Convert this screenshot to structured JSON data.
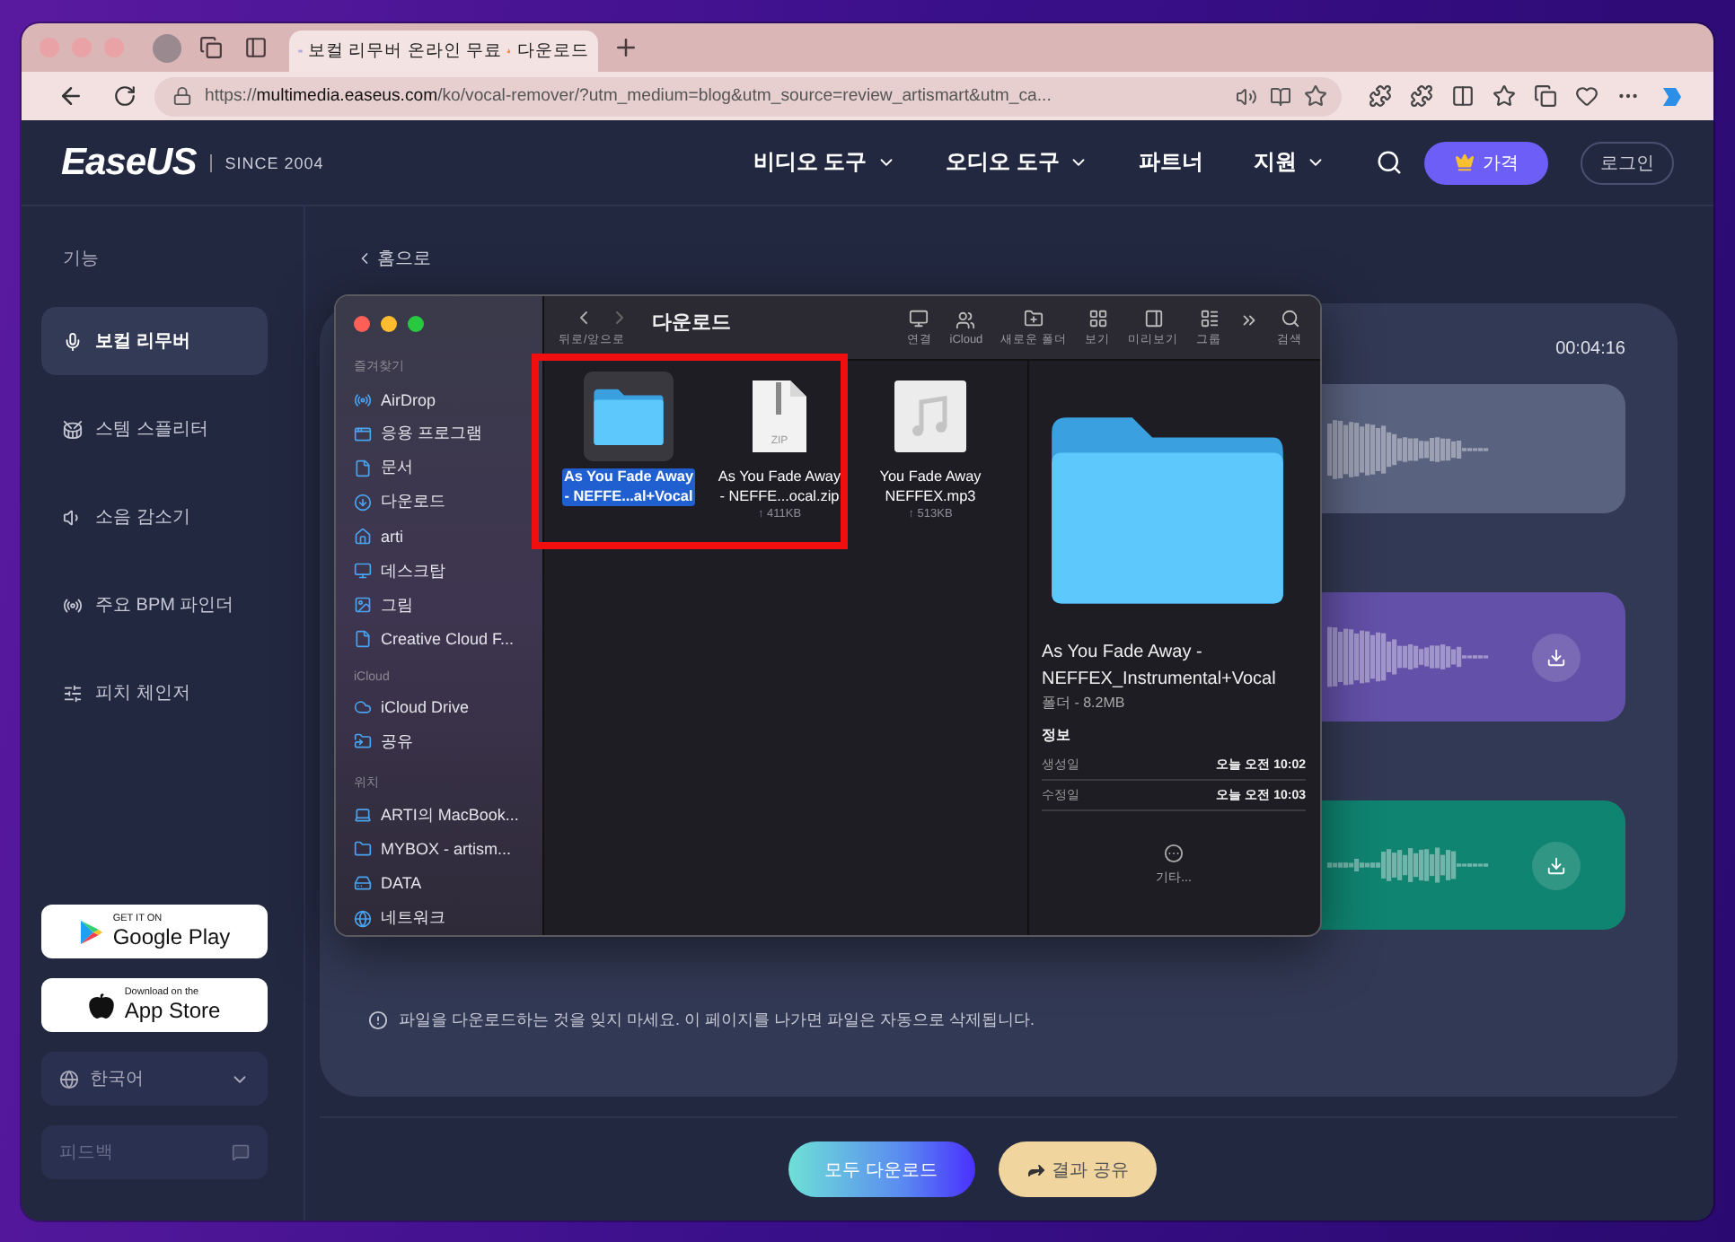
{
  "browser": {
    "tab_title_start": "보컬 리무버 온라인 무료",
    "tab_title_end": "다운로드",
    "url": "https://**multimedia.easeus.com**/ko/vocal-remover/?utm_medium=blog&utm_source=review_artismart&utm_ca..."
  },
  "header": {
    "logo": "EaseUS",
    "since": "SINCE 2004",
    "nav": [
      {
        "label": "비디오 도구",
        "menu": true
      },
      {
        "label": "오디오 도구",
        "menu": true
      },
      {
        "label": "파트너",
        "menu": false
      },
      {
        "label": "지원",
        "menu": true
      }
    ],
    "price_button": "가격",
    "login_button": "로그인"
  },
  "sidebar": {
    "section": "기능",
    "items": [
      {
        "label": "보컬 리무버",
        "kind": "vocal",
        "selected": true
      },
      {
        "label": "스템 스플리터",
        "kind": "stem",
        "selected": false
      },
      {
        "label": "소음 감소기",
        "kind": "noise",
        "selected": false
      },
      {
        "label": "주요 BPM 파인더",
        "kind": "bpm",
        "selected": false
      },
      {
        "label": "피치 체인저",
        "kind": "pitch",
        "selected": false
      }
    ],
    "google_play": {
      "small": "GET IT ON",
      "big": "Google Play"
    },
    "app_store": {
      "small": "Download on the",
      "big": "App Store"
    },
    "language": "한국어",
    "feedback": "피드백"
  },
  "main": {
    "back": "홈으로",
    "duration": "00:04:16",
    "tracks": [
      {
        "kind": "original",
        "color": "#59627f",
        "download": false
      },
      {
        "kind": "instrumental",
        "color": "#6350a8",
        "download": true
      },
      {
        "kind": "vocal",
        "color": "#0f8470",
        "download": true
      }
    ],
    "notice": "파일을 다운로드하는 것을 잊지 마세요. 이 페이지를 나가면 파일은 자동으로 삭제됩니다.",
    "download_all": "모두 다운로드",
    "share": "결과 공유"
  },
  "finder": {
    "title": "다운로드",
    "nav_label": "뒤로/앞으로",
    "toolbar": [
      {
        "kind": "connect",
        "label": "연결"
      },
      {
        "kind": "icloud",
        "label": "iCloud"
      },
      {
        "kind": "newfolder",
        "label": "새로운 폴더"
      },
      {
        "kind": "view",
        "label": "보기"
      },
      {
        "kind": "preview",
        "label": "미리보기"
      },
      {
        "kind": "group",
        "label": "그룹"
      },
      {
        "kind": "more"
      },
      {
        "kind": "search",
        "label": "검색"
      }
    ],
    "sections": [
      {
        "title": "즐겨찾기",
        "items": [
          {
            "kind": "airdrop",
            "label": "AirDrop"
          },
          {
            "kind": "apps",
            "label": "응용 프로그램"
          },
          {
            "kind": "docs",
            "label": "문서"
          },
          {
            "kind": "downloads",
            "label": "다운로드"
          },
          {
            "kind": "home",
            "label": "arti"
          },
          {
            "kind": "desktop",
            "label": "데스크탑"
          },
          {
            "kind": "pictures",
            "label": "그림"
          },
          {
            "kind": "file",
            "label": "Creative Cloud F..."
          }
        ]
      },
      {
        "title": "iCloud",
        "items": [
          {
            "kind": "cloud",
            "label": "iCloud Drive"
          },
          {
            "kind": "shared",
            "label": "공유"
          }
        ]
      },
      {
        "title": "위치",
        "items": [
          {
            "kind": "computer",
            "label": "ARTI의 MacBook..."
          },
          {
            "kind": "folder",
            "label": "MYBOX - artism..."
          },
          {
            "kind": "disk",
            "label": "DATA"
          },
          {
            "kind": "network",
            "label": "네트워크"
          }
        ]
      }
    ],
    "files": [
      {
        "kind": "folder",
        "lines": [
          "As You Fade Away",
          "- NEFFE...al+Vocal"
        ],
        "selected": true
      },
      {
        "kind": "zip",
        "lines": [
          "As You Fade Away",
          "- NEFFE...ocal.zip"
        ],
        "size": "↑ 411KB",
        "badge": "ZIP",
        "selected": false
      },
      {
        "kind": "audio",
        "lines": [
          "You Fade Away",
          "NEFFEX.mp3"
        ],
        "size": "↑ 513KB",
        "selected": false
      }
    ],
    "preview": {
      "name": "As You Fade Away - NEFFEX_Instrumental+Vocal",
      "meta": "폴더 - 8.2MB",
      "info_title": "정보",
      "rows": [
        {
          "label": "생성일",
          "value": "오늘 오전 10:02"
        },
        {
          "label": "수정일",
          "value": "오늘 오전 10:03"
        }
      ],
      "more": "기타..."
    }
  }
}
